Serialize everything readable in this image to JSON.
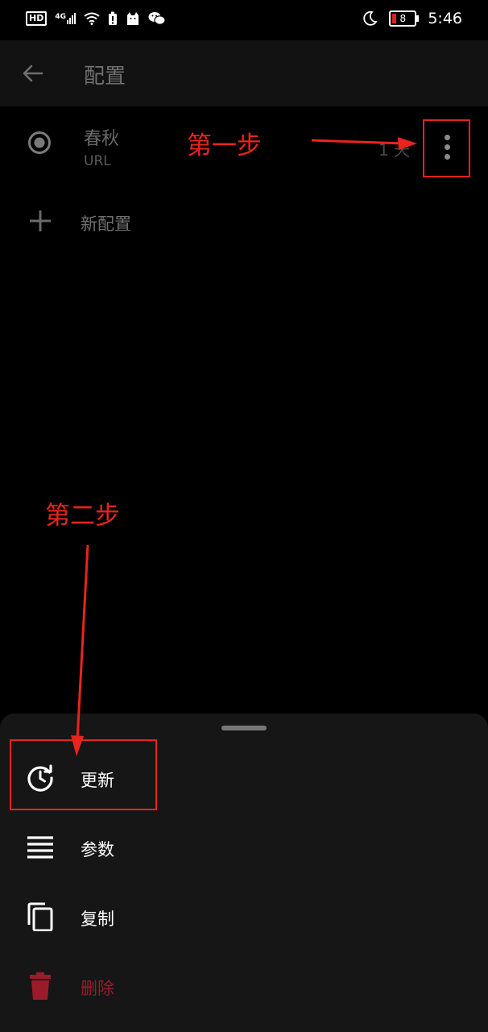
{
  "status_bar": {
    "left_icons": [
      "hd-icon",
      "signal-4g-icon",
      "wifi-icon",
      "battery-saver-icon",
      "cat-app-icon",
      "wechat-icon"
    ],
    "hd_label": "HD",
    "net_label": "4G",
    "battery_level": "8",
    "time": "5:46"
  },
  "app_bar": {
    "title": "配置"
  },
  "profile": {
    "name": "春秋",
    "type": "URL",
    "meta": "1 天"
  },
  "new_profile": {
    "label": "新配置"
  },
  "bottom_sheet": {
    "items": [
      {
        "label": "更新",
        "icon": "update-clock-icon"
      },
      {
        "label": "参数",
        "icon": "settings-lines-icon"
      },
      {
        "label": "复制",
        "icon": "copy-icon"
      },
      {
        "label": "删除",
        "icon": "trash-icon"
      }
    ]
  },
  "annotations": {
    "step1": "第一步",
    "step2": "第二步"
  },
  "colors": {
    "annotation_red": "#e8241d",
    "delete_red": "#9b1b2b",
    "sheet_bg": "#161616"
  }
}
